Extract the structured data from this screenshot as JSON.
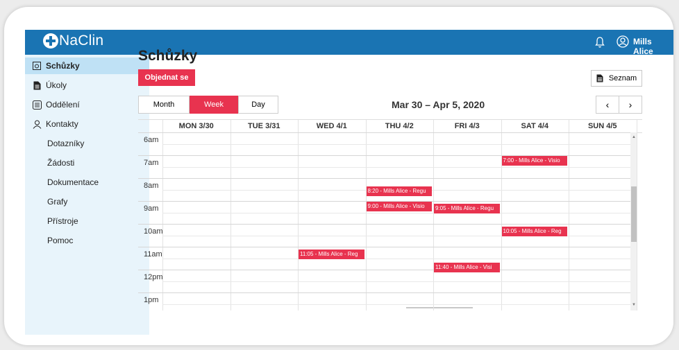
{
  "app": {
    "name": "NaClin"
  },
  "header": {
    "user_name": "Mills Alice",
    "icons": [
      "bell-icon",
      "user-circle-icon"
    ]
  },
  "sidebar": {
    "items": [
      {
        "label": "Schůzky",
        "icon": "calendar-icon",
        "active": true
      },
      {
        "label": "Úkoly",
        "icon": "document-icon"
      },
      {
        "label": "Oddělení",
        "icon": "list-box-icon"
      },
      {
        "label": "Kontakty",
        "icon": "person-icon"
      },
      {
        "label": "Dotazníky"
      },
      {
        "label": "Žádosti"
      },
      {
        "label": "Dokumentace"
      },
      {
        "label": "Grafy"
      },
      {
        "label": "Přístroje"
      },
      {
        "label": "Pomoc"
      }
    ]
  },
  "main": {
    "title": "Schůzky",
    "book_button": "Objednat se",
    "list_button": "Seznam",
    "views": [
      "Month",
      "Week",
      "Day"
    ],
    "active_view": "Week",
    "date_range": "Mar 30 – Apr 5, 2020",
    "nav_prev": "‹",
    "nav_next": "›"
  },
  "calendar": {
    "days": [
      "MON 3/30",
      "TUE 3/31",
      "WED 4/1",
      "THU 4/2",
      "FRI 4/3",
      "SAT 4/4",
      "SUN 4/5"
    ],
    "times": [
      "6am",
      "7am",
      "8am",
      "9am",
      "10am",
      "11am",
      "12pm",
      "1pm"
    ],
    "events": [
      {
        "day": 5,
        "start": "7:00",
        "text": "7:00 - Mills Alice - Visio"
      },
      {
        "day": 3,
        "start": "8:20",
        "text": "8:20 - Mills Alice - Regu"
      },
      {
        "day": 3,
        "start": "9:00",
        "text": "9:00 - Mills Alice - Visio"
      },
      {
        "day": 4,
        "start": "9:05",
        "text": "9:05 - Mills Alice - Regu"
      },
      {
        "day": 5,
        "start": "10:05",
        "text": "10:05 - Mills Alice - Reg"
      },
      {
        "day": 2,
        "start": "11:05",
        "text": "11:05 - Mills Alice - Reg"
      },
      {
        "day": 4,
        "start": "11:40",
        "text": "11:40 - Mills Alice - Visi"
      }
    ]
  },
  "colors": {
    "header": "#1a74b3",
    "accent": "#e8334f",
    "sidebar": "#e8f4fb",
    "sidebar_active": "#bfe1f5"
  }
}
